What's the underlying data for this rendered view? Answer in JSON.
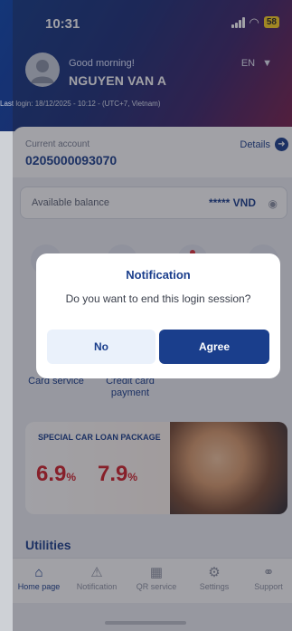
{
  "status_bar": {
    "time": "10:31",
    "battery": "58"
  },
  "profile": {
    "greeting": "Good morning!",
    "name": "NGUYEN VAN A",
    "language": "EN",
    "last_login": "Last login: 18/12/2025 - 10:12 - (UTC+7, Vietnam)"
  },
  "account": {
    "label": "Current account",
    "number": "0205000093070",
    "details_label": "Details"
  },
  "balance": {
    "label": "Available balance",
    "value": "***** VND"
  },
  "quick_actions": [
    {
      "label": "Card service"
    },
    {
      "label": "Credit card payment"
    }
  ],
  "banner": {
    "title": "SPECIAL CAR LOAN PACKAGE",
    "rate1": "6.9",
    "rate2": "7.9",
    "percent": "%"
  },
  "utilities_title": "Utilities",
  "bottom_nav": {
    "items": [
      {
        "label": "Home page",
        "icon": "home-icon"
      },
      {
        "label": "Notification",
        "icon": "bell-icon"
      },
      {
        "label": "QR service",
        "icon": "qr-icon"
      },
      {
        "label": "Settings",
        "icon": "gear-icon"
      },
      {
        "label": "Support",
        "icon": "headset-icon"
      }
    ]
  },
  "dialog": {
    "title": "Notification",
    "message": "Do you want to end this login session?",
    "no_label": "No",
    "agree_label": "Agree"
  },
  "colors": {
    "brand": "#1a3e8c",
    "accent_red": "#d3222a",
    "battery": "#ffd21f"
  }
}
